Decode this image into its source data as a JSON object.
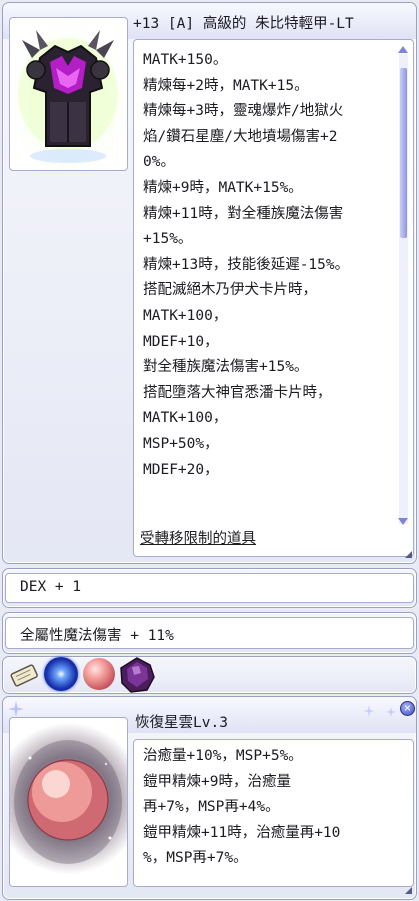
{
  "item_window": {
    "title": "+13 [A] 高級的 朱比特輕甲-LT",
    "icon": "purple-spiked-armor-icon",
    "description_lines": [
      "MATK+150。",
      "精煉每+2時，MATK+15。",
      "精煉每+3時，靈魂爆炸/地獄火",
      "焰/鑽石星塵/大地墳場傷害+2",
      "0%。",
      "精煉+9時，MATK+15%。",
      "精煉+11時，對全種族魔法傷害",
      "+15%。",
      "精煉+13時，技能後延遲-15%。",
      "搭配滅絕木乃伊犬卡片時，",
      "MATK+100，",
      "MDEF+10，",
      "對全種族魔法傷害+15%。",
      "搭配墮落大神官悉潘卡片時，",
      "MATK+100，",
      "MSP+50%，",
      "MDEF+20，"
    ],
    "trade_restriction": "受轉移限制的道具"
  },
  "random_options": [
    "DEX + 1",
    "全屬性魔法傷害 + 11%"
  ],
  "slots": [
    {
      "icon": "enchant-scroll-icon"
    },
    {
      "icon": "blue-star-orb-icon"
    },
    {
      "icon": "pink-orb-icon"
    },
    {
      "icon": "dark-purple-gem-icon"
    }
  ],
  "card_window": {
    "title": "恢復星雲Lv.3",
    "icon": "pink-nebula-orb-icon",
    "description_lines": [
      "治癒量+10%，MSP+5%。",
      "鎧甲精煉+9時，治癒量",
      "再+7%，MSP再+4%。",
      "鎧甲精煉+11時，治癒量再+10",
      "%，MSP再+7%。"
    ],
    "close_label": "×"
  },
  "colors": {
    "panel_border": "#9aa1c9",
    "scroll_thumb": "#8d96e0",
    "title_bar": "#dfe2f5"
  }
}
